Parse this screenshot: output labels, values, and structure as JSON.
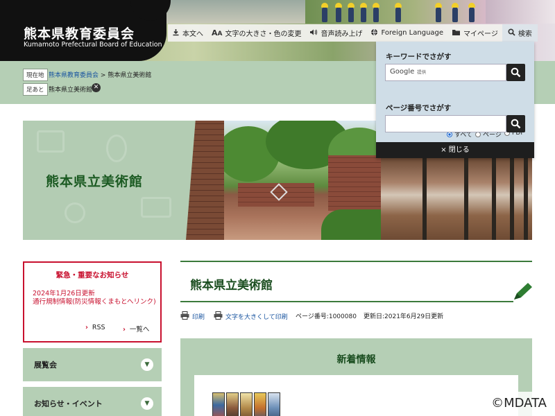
{
  "header": {
    "title": "熊本県教育委員会",
    "subtitle": "Kumamoto Prefectural Board of Education",
    "utility_nav": [
      {
        "icon": "download-arrow-icon",
        "label": "本文へ"
      },
      {
        "icon": "text-size-icon",
        "label": "文字の大きさ・色の変更"
      },
      {
        "icon": "speaker-icon",
        "label": "音声読み上げ"
      },
      {
        "icon": "globe-icon",
        "label": "Foreign Language"
      },
      {
        "icon": "folder-icon",
        "label": "マイページ"
      },
      {
        "icon": "search-icon",
        "label": "検索"
      }
    ]
  },
  "breadcrumb": {
    "current_label": "現在地",
    "home_link": "熊本県教育委員会",
    "separator": ">",
    "current_page": "熊本県立美術館",
    "footprint_label": "足あと",
    "footprint_item": "熊本県立美術館"
  },
  "search_panel": {
    "keyword_label": "キーワードでさがす",
    "google_text": "Google",
    "google_sub": "提供",
    "radio_options": [
      {
        "label": "すべて",
        "selected": true
      },
      {
        "label": "ページ",
        "selected": false
      },
      {
        "label": "PDF",
        "selected": false
      }
    ],
    "page_number_label": "ページ番号でさがす",
    "close_label": "閉じる",
    "close_icon": "×"
  },
  "hero": {
    "title": "熊本県立美術館"
  },
  "notice": {
    "title": "緊急・重要なお知らせ",
    "date": "2024年1月26日更新",
    "link": "通行規制情報(防災情報くまもとへリンク)",
    "rss": "RSS",
    "list": "一覧へ",
    "accent": "#c8102e"
  },
  "side_menu": [
    {
      "label": "展覧会"
    },
    {
      "label": "お知らせ・イベント"
    }
  ],
  "page": {
    "title": "熊本県立美術館",
    "print": "印刷",
    "print_large": "文字を大きくして印刷",
    "page_number": "ページ番号:1000080",
    "updated": "更新日:2021年6月29日更新"
  },
  "news": {
    "title": "新着情報"
  },
  "watermark": "©MDATA",
  "colors": {
    "green_band": "#b5cfb5",
    "title_green": "#1b4e20",
    "link_blue": "#1a55a0"
  }
}
